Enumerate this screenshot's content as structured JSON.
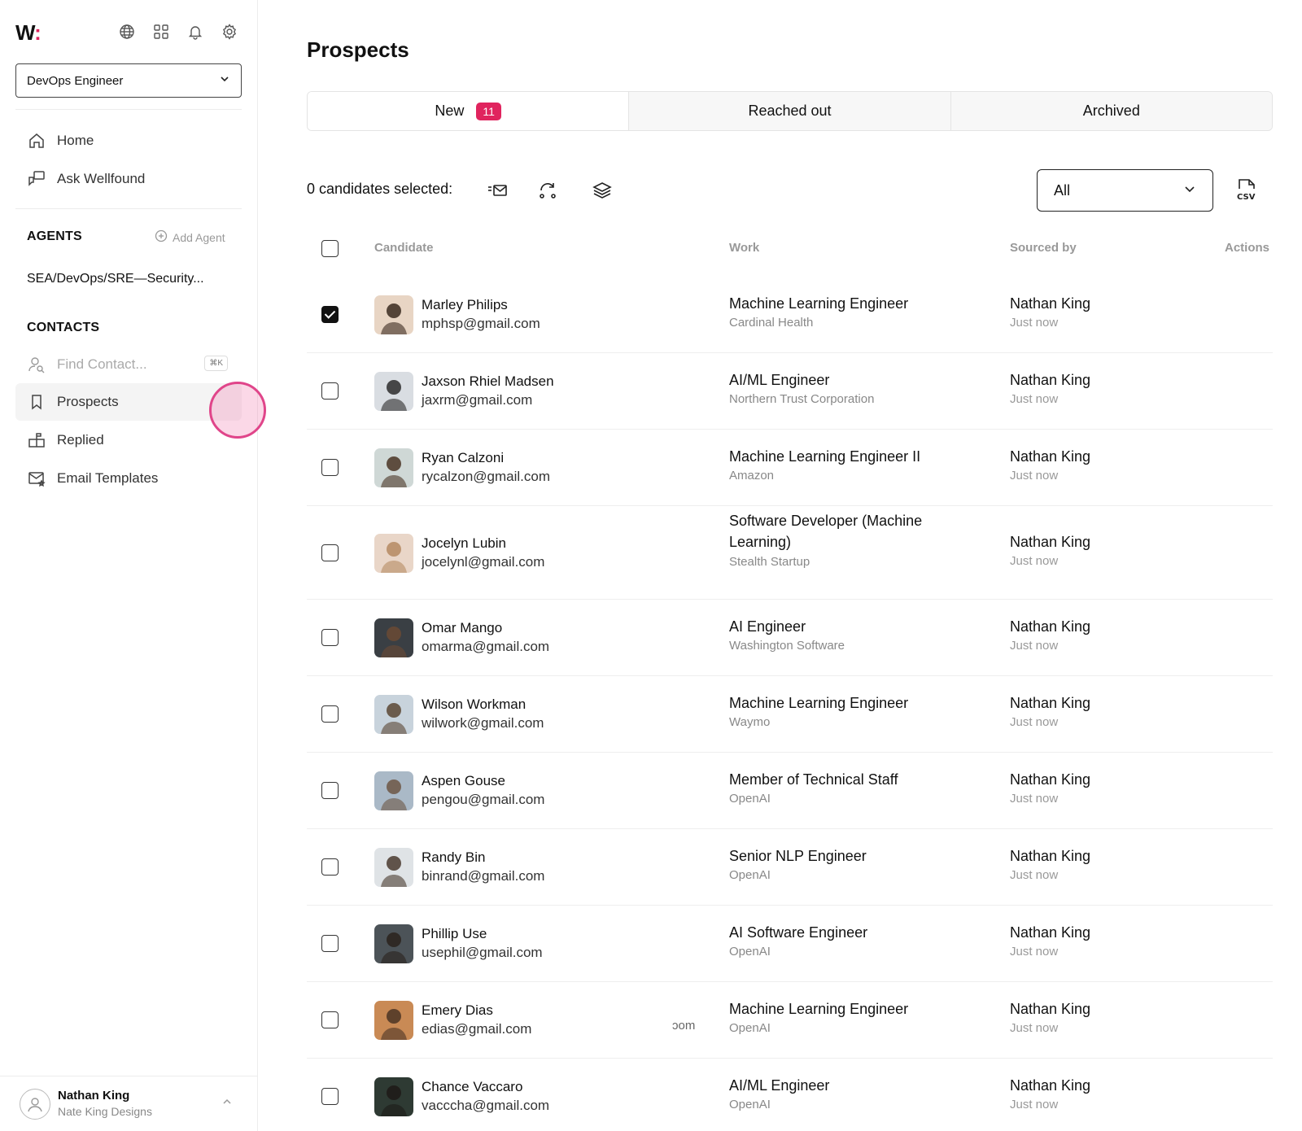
{
  "brand": {
    "logo_text": "W",
    "logo_dot": ":",
    "accent": "#e0245e"
  },
  "topbar_icons": [
    "globe-icon",
    "grid-icon",
    "bell-icon",
    "gear-icon"
  ],
  "role_select": {
    "value": "DevOps Engineer"
  },
  "nav": {
    "home": "Home",
    "ask": "Ask Wellfound"
  },
  "agents": {
    "heading": "AGENTS",
    "add_label": "Add Agent",
    "items": [
      "SEA/DevOps/SRE—Security..."
    ]
  },
  "contacts": {
    "heading": "CONTACTS",
    "find_placeholder": "Find Contact...",
    "shortcut": "⌘K",
    "items": [
      "Prospects",
      "Replied",
      "Email Templates"
    ]
  },
  "user": {
    "name": "Nathan King",
    "org": "Nate King Designs"
  },
  "page": {
    "title": "Prospects"
  },
  "tabs": [
    {
      "label": "New",
      "count": "11"
    },
    {
      "label": "Reached out"
    },
    {
      "label": "Archived"
    }
  ],
  "toolbar": {
    "selected_label": "0 candidates selected:",
    "filter_value": "All"
  },
  "table": {
    "headers": {
      "candidate": "Candidate",
      "work": "Work",
      "sourced": "Sourced by",
      "actions": "Actions"
    },
    "rows": [
      {
        "name": "Marley Philips",
        "email": "mphsp@gmail.com",
        "title": "Machine Learning Engineer",
        "company": "Cardinal Health",
        "sourced_by": "Nathan King",
        "time": "Just now",
        "checked": true
      },
      {
        "name": "Jaxson Rhiel Madsen",
        "email": "jaxrm@gmail.com",
        "title": "AI/ML Engineer",
        "company": "Northern Trust Corporation",
        "sourced_by": "Nathan King",
        "time": "Just now",
        "checked": false
      },
      {
        "name": "Ryan Calzoni",
        "email": "rycalzon@gmail.com",
        "title": "Machine Learning Engineer II",
        "company": "Amazon",
        "sourced_by": "Nathan King",
        "time": "Just now",
        "checked": false
      },
      {
        "name": "Jocelyn Lubin",
        "email": "jocelynl@gmail.com",
        "title": "Software Developer (Machine Learning)",
        "company": "Stealth Startup",
        "sourced_by": "Nathan King",
        "time": "Just now",
        "checked": false
      },
      {
        "name": "Omar Mango",
        "email": "omarma@gmail.com",
        "title": "AI Engineer",
        "company": "Washington Software",
        "sourced_by": "Nathan King",
        "time": "Just now",
        "checked": false
      },
      {
        "name": "Wilson Workman",
        "email": "wilwork@gmail.com",
        "title": "Machine Learning Engineer",
        "company": "Waymo",
        "sourced_by": "Nathan King",
        "time": "Just now",
        "checked": false
      },
      {
        "name": "Aspen Gouse",
        "email": "pengou@gmail.com",
        "title": "Member of Technical Staff",
        "company": "OpenAI",
        "sourced_by": "Nathan King",
        "time": "Just now",
        "checked": false
      },
      {
        "name": "Randy Bin",
        "email": "binrand@gmail.com",
        "title": "Senior NLP Engineer",
        "company": "OpenAI",
        "sourced_by": "Nathan King",
        "time": "Just now",
        "checked": false
      },
      {
        "name": "Phillip Use",
        "email": "usephil@gmail.com",
        "title": "AI Software Engineer",
        "company": "OpenAI",
        "sourced_by": "Nathan King",
        "time": "Just now",
        "checked": false
      },
      {
        "name": "Emery Dias",
        "email": "edias@gmail.com",
        "title": "Machine Learning Engineer",
        "company": "OpenAI",
        "sourced_by": "Nathan King",
        "time": "Just now",
        "checked": false,
        "stray": "ɔom"
      },
      {
        "name": "Chance Vaccaro",
        "email": "vacccha@gmail.com",
        "title": "AI/ML Engineer",
        "company": "OpenAI",
        "sourced_by": "Nathan King",
        "time": "Just now",
        "checked": false
      }
    ]
  }
}
